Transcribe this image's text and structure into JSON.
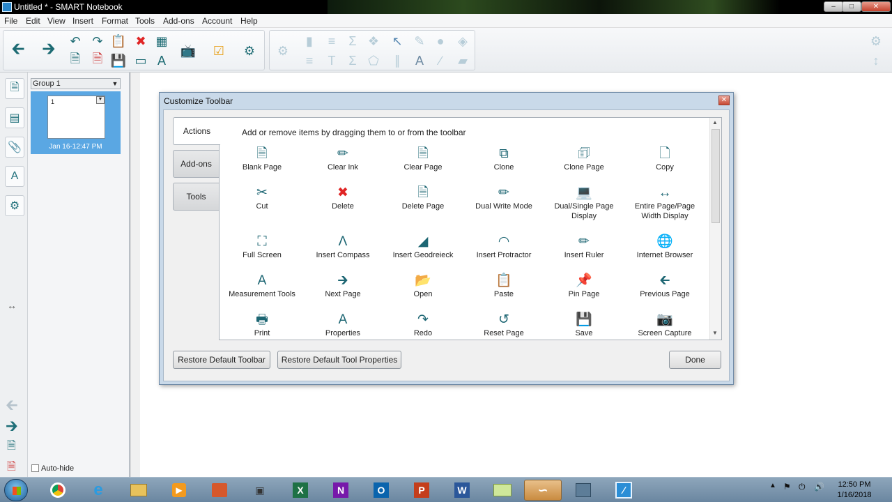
{
  "window": {
    "title": "Untitled * - SMART Notebook"
  },
  "menu": [
    "File",
    "Edit",
    "View",
    "Insert",
    "Format",
    "Tools",
    "Add-ons",
    "Account",
    "Help"
  ],
  "sorter": {
    "group": "Group 1",
    "page_number": "1",
    "page_label": "Jan 16-12:47 PM",
    "autohide": "Auto-hide"
  },
  "dialog": {
    "title": "Customize Toolbar",
    "hint": "Add or remove items by dragging them to or from the toolbar",
    "tabs": [
      "Actions",
      "Add-ons",
      "Tools"
    ],
    "active_tab": "Actions",
    "items": [
      {
        "label": "Blank Page",
        "icon": "blank-page-icon"
      },
      {
        "label": "Clear Ink",
        "icon": "clear-ink-icon"
      },
      {
        "label": "Clear Page",
        "icon": "clear-page-icon"
      },
      {
        "label": "Clone",
        "icon": "clone-icon"
      },
      {
        "label": "Clone Page",
        "icon": "clone-page-icon"
      },
      {
        "label": "Copy",
        "icon": "copy-icon"
      },
      {
        "label": "Cut",
        "icon": "scissors-icon"
      },
      {
        "label": "Delete",
        "icon": "delete-icon"
      },
      {
        "label": "Delete Page",
        "icon": "delete-page-icon"
      },
      {
        "label": "Dual Write Mode",
        "icon": "dual-write-icon"
      },
      {
        "label": "Dual/Single Page Display",
        "icon": "dual-single-page-icon"
      },
      {
        "label": "Entire Page/Page Width Display",
        "icon": "entire-page-icon"
      },
      {
        "label": "Full Screen",
        "icon": "full-screen-icon"
      },
      {
        "label": "Insert Compass",
        "icon": "compass-icon"
      },
      {
        "label": "Insert Geodreieck",
        "icon": "geodreieck-icon"
      },
      {
        "label": "Insert Protractor",
        "icon": "protractor-icon"
      },
      {
        "label": "Insert Ruler",
        "icon": "ruler-icon"
      },
      {
        "label": "Internet Browser",
        "icon": "globe-icon"
      },
      {
        "label": "Measurement Tools",
        "icon": "measurement-icon"
      },
      {
        "label": "Next Page",
        "icon": "next-arrow-icon"
      },
      {
        "label": "Open",
        "icon": "open-folder-icon"
      },
      {
        "label": "Paste",
        "icon": "paste-icon"
      },
      {
        "label": "Pin Page",
        "icon": "pin-icon"
      },
      {
        "label": "Previous Page",
        "icon": "previous-arrow-icon"
      },
      {
        "label": "Print",
        "icon": "print-icon"
      },
      {
        "label": "Properties",
        "icon": "properties-icon"
      },
      {
        "label": "Redo",
        "icon": "redo-icon"
      },
      {
        "label": "Reset Page",
        "icon": "reset-page-icon"
      },
      {
        "label": "Save",
        "icon": "save-icon"
      },
      {
        "label": "Screen Capture",
        "icon": "camera-icon"
      }
    ],
    "buttons": {
      "restore_toolbar": "Restore Default Toolbar",
      "restore_props": "Restore Default Tool Properties",
      "done": "Done"
    }
  },
  "clock": {
    "time": "12:50 PM",
    "date": "1/16/2018"
  },
  "taskbar": [
    "Chrome",
    "Internet Explorer",
    "File Explorer",
    "Media Player",
    "PowerPoint Viewer",
    "Sound",
    "Excel",
    "OneNote",
    "Outlook",
    "PowerPoint",
    "Word",
    "Notes",
    "SMART Tools",
    "Network",
    "SMART Notebook"
  ],
  "colors": {
    "accent": "#1d6673",
    "delete": "#e02525",
    "selected_thumb": "#5aa7e3"
  }
}
